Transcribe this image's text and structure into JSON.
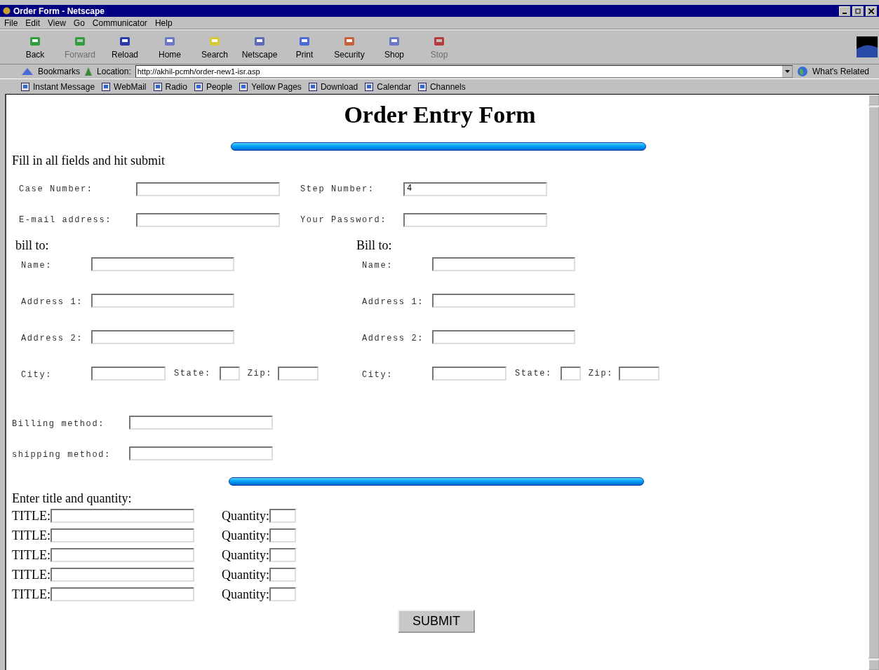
{
  "window": {
    "title": "Order Form - Netscape"
  },
  "menu": [
    "File",
    "Edit",
    "View",
    "Go",
    "Communicator",
    "Help"
  ],
  "toolbar": [
    {
      "label": "Back",
      "disabled": false,
      "color": "#2e9e3e"
    },
    {
      "label": "Forward",
      "disabled": true,
      "color": "#2e9e3e"
    },
    {
      "label": "Reload",
      "disabled": false,
      "color": "#2a3aa8"
    },
    {
      "label": "Home",
      "disabled": false,
      "color": "#6b78c8"
    },
    {
      "label": "Search",
      "disabled": false,
      "color": "#d8c838"
    },
    {
      "label": "Netscape",
      "disabled": false,
      "color": "#5a6ab8"
    },
    {
      "label": "Print",
      "disabled": false,
      "color": "#4a6ad8"
    },
    {
      "label": "Security",
      "disabled": false,
      "color": "#c8603a"
    },
    {
      "label": "Shop",
      "disabled": false,
      "color": "#6a78c8"
    },
    {
      "label": "Stop",
      "disabled": true,
      "color": "#b83a3a"
    }
  ],
  "location": {
    "bookmarks": "Bookmarks",
    "label": "Location:",
    "url": "http://akhil-pcmh/order-new1-isr.asp",
    "related": "What's Related"
  },
  "personal_toolbar": [
    "Instant Message",
    "WebMail",
    "Radio",
    "People",
    "Yellow Pages",
    "Download",
    "Calendar",
    "Channels"
  ],
  "page": {
    "heading": "Order Entry Form",
    "instructions": "Fill in all fields and hit submit",
    "top_fields": [
      {
        "label": "Case Number:"
      },
      {
        "label": "Step Number:",
        "value": "4"
      },
      {
        "label": "E-mail address:"
      },
      {
        "label": "Your Password:"
      }
    ],
    "addresses": [
      {
        "heading": "bill to:",
        "name": "Name:",
        "address1": "Address 1:",
        "address2": "Address 2:",
        "city": "City:",
        "state": "State:",
        "zip": "Zip:"
      },
      {
        "heading": "Bill to:",
        "name": "Name:",
        "address1": "Address 1:",
        "address2": "Address 2:",
        "city": "City:",
        "state": "State:",
        "zip": "Zip:"
      }
    ],
    "methods": [
      {
        "label": "Billing method:"
      },
      {
        "label": "shipping method:"
      }
    ],
    "items_heading": "Enter title and quantity:",
    "items": [
      {
        "title": "TITLE:",
        "quantity": "Quantity:"
      },
      {
        "title": "TITLE:",
        "quantity": "Quantity:"
      },
      {
        "title": "TITLE:",
        "quantity": "Quantity:"
      },
      {
        "title": "TITLE:",
        "quantity": "Quantity:"
      },
      {
        "title": "TITLE:",
        "quantity": "Quantity:"
      }
    ],
    "submit": "SUBMIT"
  }
}
